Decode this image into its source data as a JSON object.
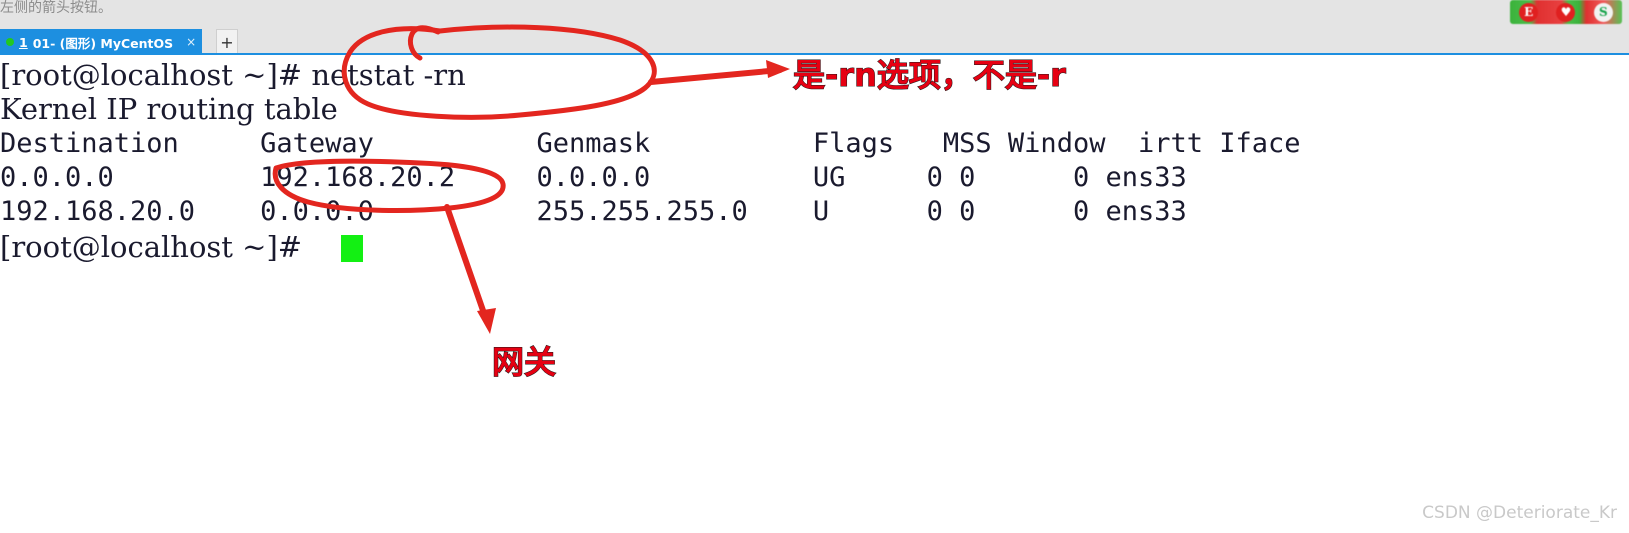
{
  "chrome": {
    "hint_text": "左侧的箭头按钮。",
    "tab": {
      "index": "1",
      "title": "01- (图形)  MyCentOS",
      "close_label": "×",
      "status": "running"
    },
    "new_tab_label": "+",
    "corner_badge": {
      "chip1": "E",
      "chip2": "♥",
      "chip3": "S"
    }
  },
  "terminal": {
    "prompt": "[root@localhost ~]#",
    "command": "netstat -rn",
    "heading": "Kernel IP routing table",
    "columns": [
      "Destination",
      "Gateway",
      "Genmask",
      "Flags",
      "MSS",
      "Window",
      "irtt",
      "Iface"
    ],
    "rows": [
      {
        "destination": "0.0.0.0",
        "gateway": "192.168.20.2",
        "genmask": "0.0.0.0",
        "flags": "UG",
        "mss": "0",
        "window": "0",
        "irtt": "0",
        "iface": "ens33"
      },
      {
        "destination": "192.168.20.0",
        "gateway": "0.0.0.0",
        "genmask": "255.255.255.0",
        "flags": "U",
        "mss": "0",
        "window": "0",
        "irtt": "0",
        "iface": "ens33"
      }
    ],
    "final_prompt": "[root@localhost ~]#",
    "cursor": "block"
  },
  "annotations": {
    "note_command": "是-rn选项，不是-r",
    "note_gateway": "网关",
    "ink_color": "#e3261f",
    "text_color": "#e60012"
  },
  "watermark": "CSDN @Deteriorate_Kr"
}
